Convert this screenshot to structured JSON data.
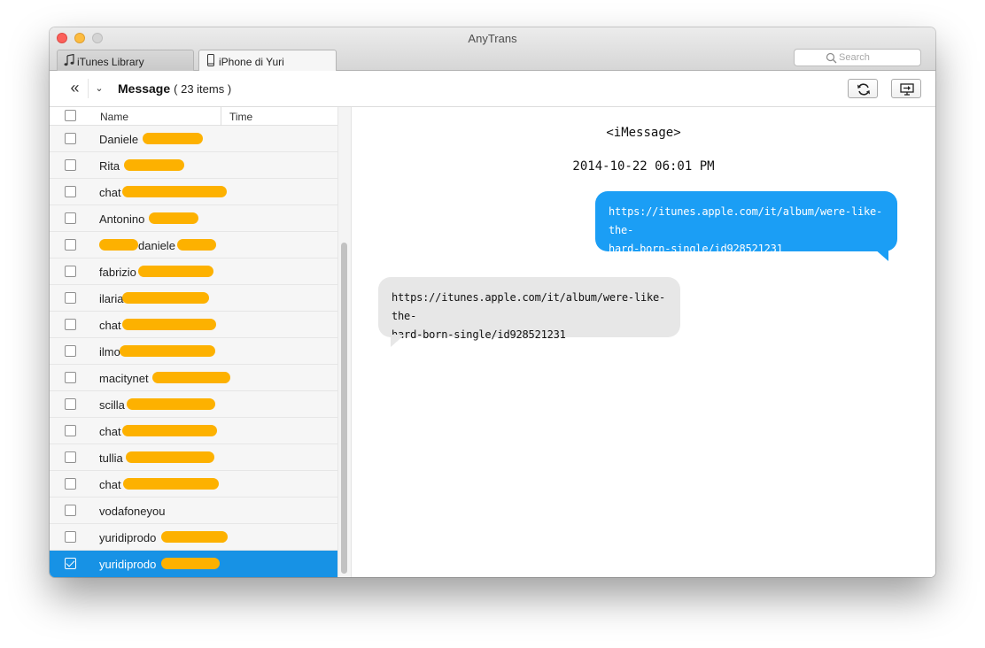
{
  "window": {
    "title": "AnyTrans"
  },
  "tabs": [
    {
      "label": "iTunes Library",
      "icon": "music-note-icon"
    },
    {
      "label": "iPhone di Yuri",
      "icon": "iphone-icon"
    }
  ],
  "search": {
    "placeholder": "Search"
  },
  "toolbar": {
    "title": "Message",
    "count": "( 23 items )"
  },
  "list": {
    "columns": [
      "Name",
      "Time"
    ],
    "rows": [
      {
        "name": "Daniele",
        "checked": false
      },
      {
        "name": "Rita",
        "checked": false
      },
      {
        "name": "chat",
        "checked": false
      },
      {
        "name": "Antonino",
        "checked": false
      },
      {
        "name": "daniele",
        "checked": false
      },
      {
        "name": "fabrizio",
        "checked": false
      },
      {
        "name": "ilaria",
        "checked": false
      },
      {
        "name": "chat",
        "checked": false
      },
      {
        "name": "ilmo",
        "checked": false
      },
      {
        "name": "macitynet",
        "checked": false
      },
      {
        "name": "scilla",
        "checked": false
      },
      {
        "name": "chat",
        "checked": false
      },
      {
        "name": "tullia",
        "checked": false
      },
      {
        "name": "chat",
        "checked": false
      },
      {
        "name": "vodafoneyou",
        "checked": false
      },
      {
        "name": "yuridiprodo",
        "checked": false
      },
      {
        "name": "yuridiprodo",
        "checked": true
      }
    ]
  },
  "conversation": {
    "type": "<iMessage>",
    "timestamp": "2014-10-22 06:01 PM",
    "sent_line1": "https://itunes.apple.com/it/album/were-like-the-",
    "sent_line2": "hard-born-single/id928521231",
    "received_line1": "https://itunes.apple.com/it/album/were-like-the-",
    "received_line2": "hard-born-single/id928521231"
  },
  "colors": {
    "selection": "#1792e5",
    "sent_bubble": "#1b9ef5",
    "received_bubble": "#e7e7e7",
    "redaction": "#fdb100"
  }
}
